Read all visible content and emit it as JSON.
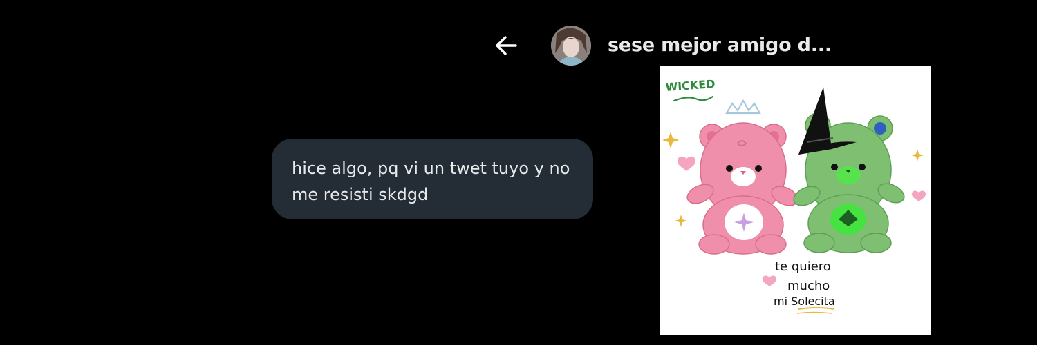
{
  "header": {
    "contact_name": "sese mejor amigo d...",
    "back_icon": "arrow-left-icon"
  },
  "messages": [
    {
      "lines": [
        "hice algo, pq vi un twet tuyo y no",
        "me resisti skdgd"
      ]
    }
  ],
  "attachment": {
    "logo_text": "WICKED",
    "caption_line1": "te quiero",
    "caption_line2": "mucho",
    "caption_line3": "mi Solecita"
  },
  "colors": {
    "background": "#000000",
    "bubble": "#242d35",
    "text": "#e7e9ea",
    "pink_bear": "#f08fab",
    "green_bear": "#7fbf72"
  }
}
